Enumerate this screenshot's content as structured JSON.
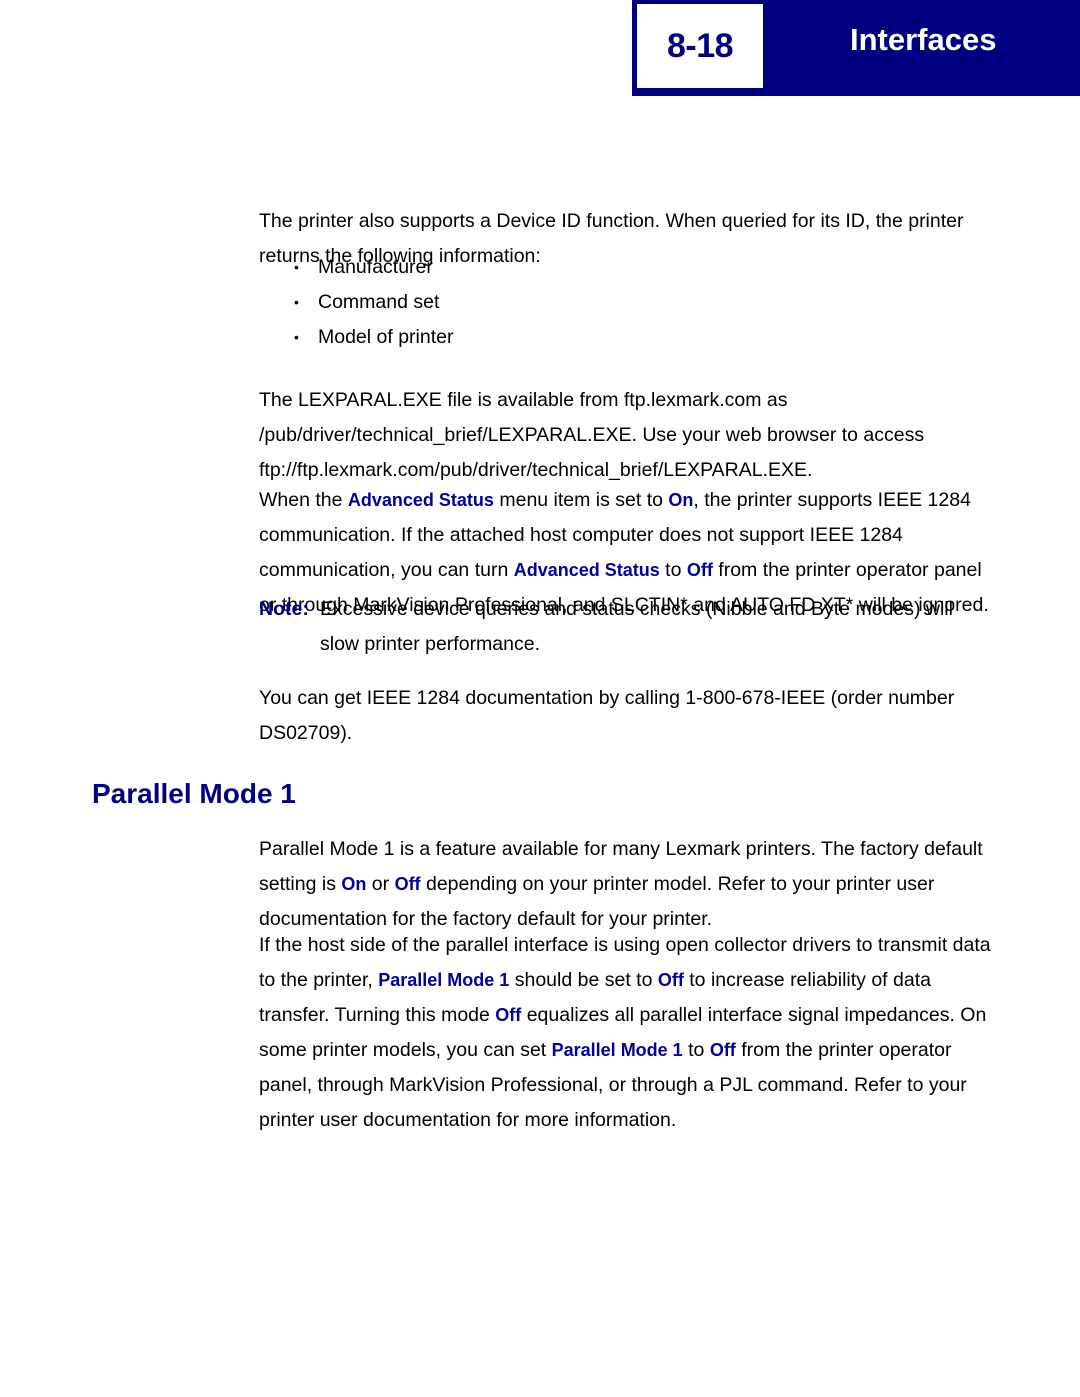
{
  "header": {
    "page_number": "8-18",
    "chapter_title": "Interfaces",
    "band_color": "#000080",
    "page_number_color": "#000080",
    "title_color": "#ffffff"
  },
  "body": {
    "para_device_id": "The printer also supports a Device ID function. When queried for its ID, the printer returns the following information:",
    "device_id_items": [
      "Manufacturer",
      "Command set",
      "Model of printer"
    ],
    "bullet_glyph": "•",
    "para_lexparal": "The LEXPARAL.EXE file is available from ftp.lexmark.com as /pub/driver/technical_brief/LEXPARAL.EXE. Use your web browser to access ftp://ftp.lexmark.com/pub/driver/technical_brief/LEXPARAL.EXE.",
    "para_advanced_status": {
      "s1": "When the ",
      "t1": "Advanced Status",
      "s2": " menu item is set to ",
      "t2": "On",
      "s3": ", the printer supports IEEE 1284 communication. If the attached host computer does not support IEEE 1284 communication, you can turn ",
      "t3": "Advanced Status",
      "s4": " to ",
      "t4": "Off",
      "s5": " from the printer operator panel or through MarkVision Professional, and SLCTIN* and AUTO FD XT* will be ignored."
    },
    "note": {
      "label": "Note:",
      "text": "Excessive device queries and status checks (Nibble and Byte modes) will slow printer performance."
    },
    "para_ieee_doc": "You can get IEEE 1284 documentation by calling 1-800-678-IEEE (order number DS02709).",
    "heading_parallel_mode": "Parallel Mode 1",
    "para_pm1_default": {
      "s1": "Parallel Mode 1 is a feature available for many Lexmark printers. The factory default setting is ",
      "t1": "On",
      "s2": " or ",
      "t2": "Off",
      "s3": " depending on your printer model. Refer to your printer user documentation for the factory default for your printer."
    },
    "para_pm1_open_collector": {
      "s1": "If the host side of the parallel interface is using open collector drivers to transmit data to the printer, ",
      "t1": "Parallel Mode 1",
      "s2": " should be set to ",
      "t2": "Off",
      "s3": " to increase reliability of data transfer. Turning this mode ",
      "t3": "Off",
      "s4": " equalizes all parallel interface signal impedances. On some printer models, you can set ",
      "t4": "Parallel Mode 1",
      "s5": " to ",
      "t5": "Off",
      "s6": " from the printer operator panel, through MarkVision Professional, or through a PJL command. Refer to your printer user documentation for more information."
    },
    "term_color": "#0000A0",
    "heading_color": "#000080"
  }
}
